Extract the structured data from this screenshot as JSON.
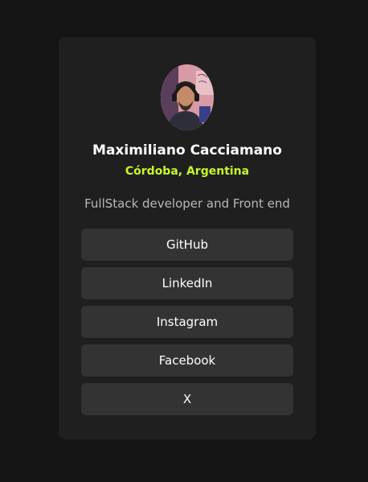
{
  "profile": {
    "name": "Maximiliano Cacciamano",
    "location": "Córdoba, Argentina",
    "bio": "FullStack developer and Front end"
  },
  "links": [
    {
      "label": "GitHub"
    },
    {
      "label": "LinkedIn"
    },
    {
      "label": "Instagram"
    },
    {
      "label": "Facebook"
    },
    {
      "label": "X"
    }
  ],
  "colors": {
    "background": "#141414",
    "card": "#1f1f1f",
    "button": "#333333",
    "accent": "#c5f82a",
    "text": "#ffffff",
    "muted": "#b8b8b8"
  }
}
